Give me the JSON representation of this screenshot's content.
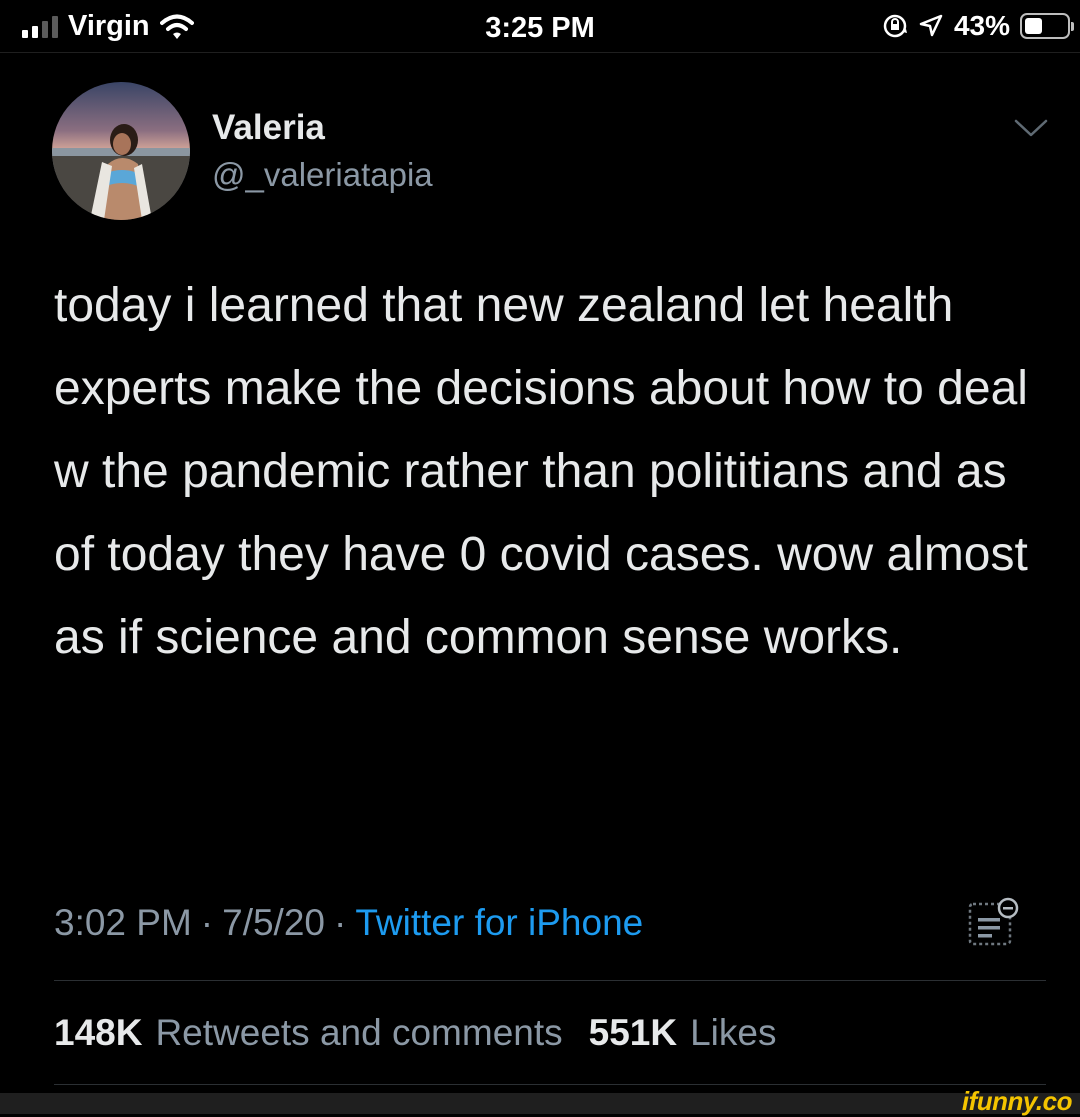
{
  "status_bar": {
    "carrier": "Virgin",
    "time": "3:25 PM",
    "battery": "43%",
    "battery_level": 0.43,
    "signal_bars": 2,
    "icons": [
      "signal-icon",
      "wifi-icon",
      "orientation-lock-icon",
      "location-icon",
      "battery-icon"
    ]
  },
  "tweet": {
    "author_name": "Valeria",
    "author_handle": "@_valeriatapia",
    "text": "today i learned that new zealand let health experts make the decisions about how to deal w the pandemic rather than polititians and as of today they have 0 covid cases. wow almost as if science and common sense works.",
    "time": "3:02 PM",
    "date": "7/5/20",
    "separator": "·",
    "source": "Twitter for iPhone",
    "retweets_count": "148K",
    "retweets_label": "Retweets and comments",
    "likes_count": "551K",
    "likes_label": "Likes"
  },
  "colors": {
    "background": "#000000",
    "link": "#1d9bf0",
    "secondary_text": "#8b98a5",
    "watermark": "#f4c400"
  },
  "watermark": "ifunny.co"
}
